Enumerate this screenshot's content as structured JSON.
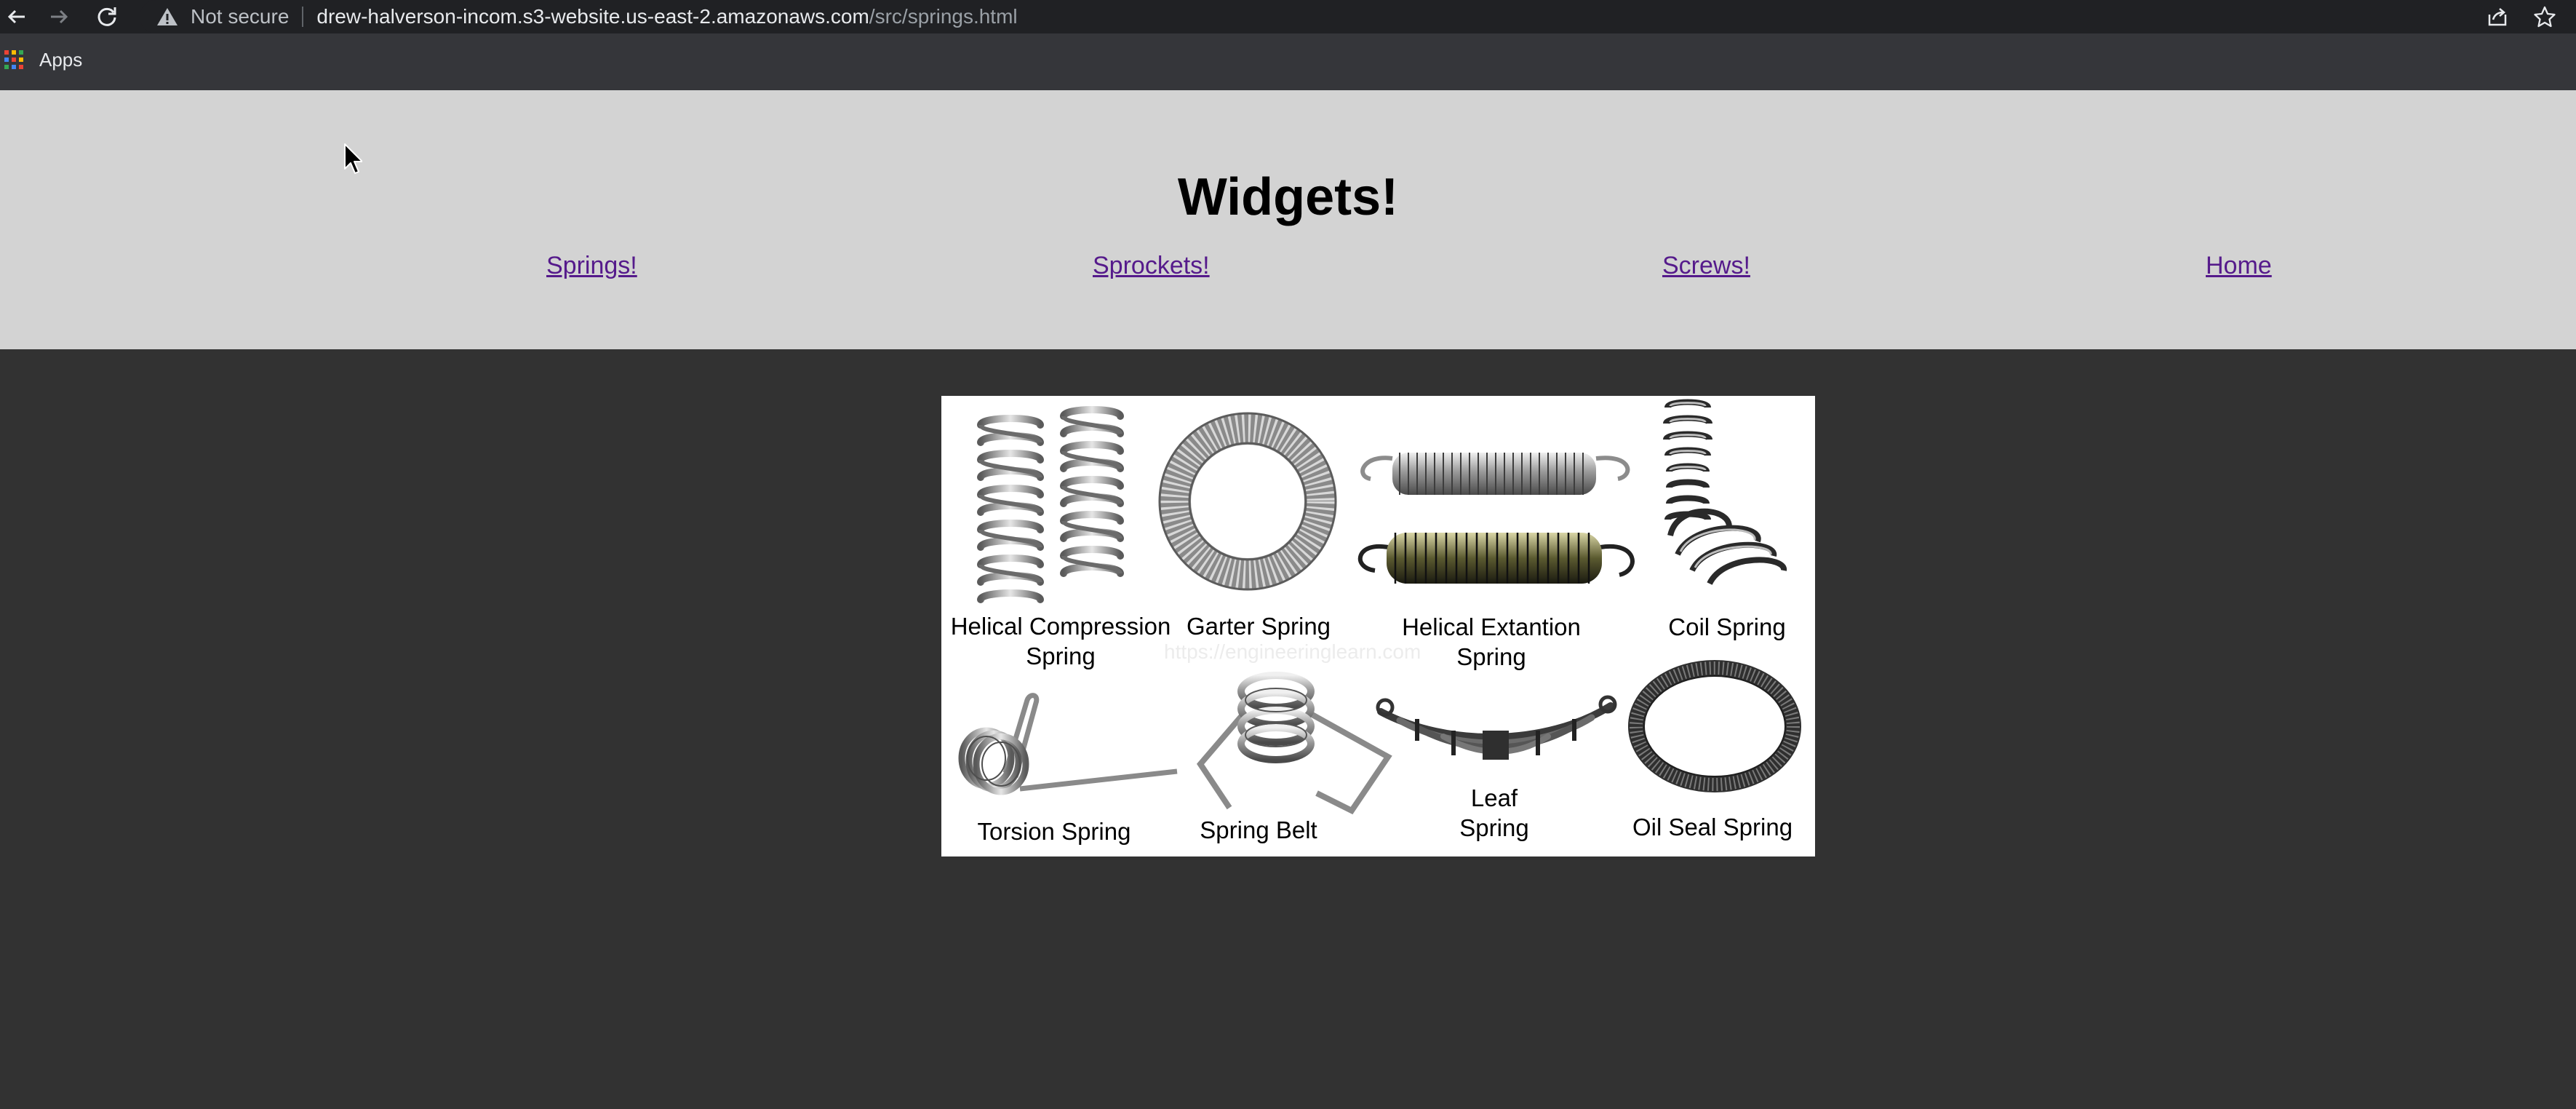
{
  "browser": {
    "security_label": "Not secure",
    "url_host": "drew-halverson-incom.s3-website.us-east-2.amazonaws.com",
    "url_path": "/src/springs.html",
    "bookmarks": {
      "apps_label": "Apps"
    }
  },
  "page": {
    "title": "Widgets!",
    "nav": {
      "springs": "Springs!",
      "sprockets": "Sprockets!",
      "screws": "Screws!",
      "home": "Home"
    }
  },
  "springs_image": {
    "watermark": "https://engineeringlearn.com",
    "captions": {
      "helical_compression": "Helical Compression\nSpring",
      "garter": "Garter Spring",
      "helical_extension": "Helical Extantion\nSpring",
      "coil": "Coil Spring",
      "torsion": "Torsion Spring",
      "spring_belt": "Spring Belt",
      "leaf": "Leaf\nSpring",
      "oil_seal": "Oil Seal Spring"
    }
  },
  "colors": {
    "header_bg": "#d3d3d3",
    "page_bg": "#323232",
    "link": "#551a8b"
  }
}
